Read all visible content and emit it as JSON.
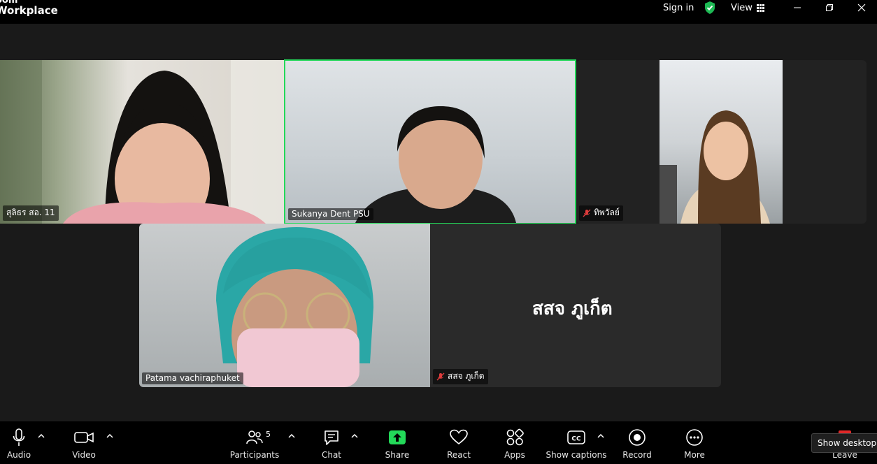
{
  "app": {
    "brand_line1": "oom",
    "brand_line2": "Workplace"
  },
  "titlebar": {
    "sign_in": "Sign in",
    "view": "View"
  },
  "participants": [
    {
      "name": "สุลิธร สอ. 11",
      "muted": false
    },
    {
      "name": "Sukanya Dent PSU",
      "muted": false,
      "active_speaker": true
    },
    {
      "name": "ทิพวัลย์",
      "muted": true
    },
    {
      "name": "Patama  vachiraphuket",
      "muted": false
    },
    {
      "name": "สสจ ภูเก็ต",
      "muted": true,
      "video_off_label": "สสจ ภูเก็ต"
    }
  ],
  "toolbar": {
    "audio": "Audio",
    "video": "Video",
    "participants": "Participants",
    "participants_count": "5",
    "chat": "Chat",
    "share": "Share",
    "react": "React",
    "apps": "Apps",
    "captions": "Show captions",
    "record": "Record",
    "more": "More",
    "leave": "Leave"
  },
  "tooltip": "Show desktop",
  "colors": {
    "active_border": "#23d959",
    "share_green": "#23d959",
    "shield_green": "#1db954",
    "leave_red": "#e02828"
  },
  "icons": [
    "microphone-icon",
    "camera-icon",
    "participants-icon",
    "chat-icon",
    "share-arrow-icon",
    "heart-icon",
    "apps-icon",
    "cc-icon",
    "record-icon",
    "more-icon",
    "shield-icon",
    "grid-icon"
  ]
}
